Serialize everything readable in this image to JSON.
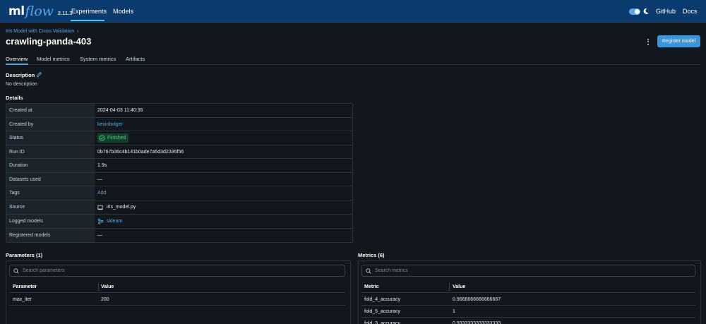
{
  "topbar": {
    "logo_ml": "ml",
    "logo_flow": "flow",
    "version": "2.11.3",
    "nav": [
      "Experiments",
      "Models"
    ],
    "github": "GitHub",
    "docs": "Docs",
    "accent": "#43c4f0",
    "background": "#0b3a6e"
  },
  "header": {
    "breadcrumb": "Iris Model with Cross Validation",
    "breadcrumb_sep": "›",
    "title": "crawling-panda-403",
    "register_button": "Register model"
  },
  "tabs": [
    "Overview",
    "Model metrics",
    "System metrics",
    "Artifacts"
  ],
  "description": {
    "label": "Description",
    "text": "No description"
  },
  "details": {
    "label": "Details",
    "rows": [
      {
        "key": "Created at",
        "value": "2024-04-03 11:40:35"
      },
      {
        "key": "Created by",
        "value": "kevinbolger"
      },
      {
        "key": "Status",
        "value": "Finished"
      },
      {
        "key": "Run ID",
        "value": "0b767b36c4b141b0ade7a5d3d2335f56"
      },
      {
        "key": "Duration",
        "value": "1.9s"
      },
      {
        "key": "Datasets used",
        "value": "—"
      },
      {
        "key": "Tags",
        "value": "Add"
      },
      {
        "key": "Source",
        "value": "iris_model.py"
      },
      {
        "key": "Logged models",
        "value": "sklearn"
      },
      {
        "key": "Registered models",
        "value": "—"
      }
    ]
  },
  "parameters": {
    "label": "Parameters (1)",
    "search_placeholder": "Search parameters",
    "columns": [
      "Parameter",
      "Value"
    ],
    "rows": [
      {
        "name": "max_iter",
        "value": "200"
      }
    ]
  },
  "metrics": {
    "label": "Metrics (6)",
    "search_placeholder": "Search metrics",
    "columns": [
      "Metric",
      "Value"
    ],
    "rows": [
      {
        "name": "fold_4_accuracy",
        "value": "0.9666666666666667"
      },
      {
        "name": "fold_5_accuracy",
        "value": "1"
      },
      {
        "name": "fold_3_accuracy",
        "value": "0.9333333333333333"
      }
    ]
  },
  "colors": {
    "link": "#5aa7e6",
    "status_success": "#4fd17a",
    "primary_button": "#3b95d6"
  }
}
